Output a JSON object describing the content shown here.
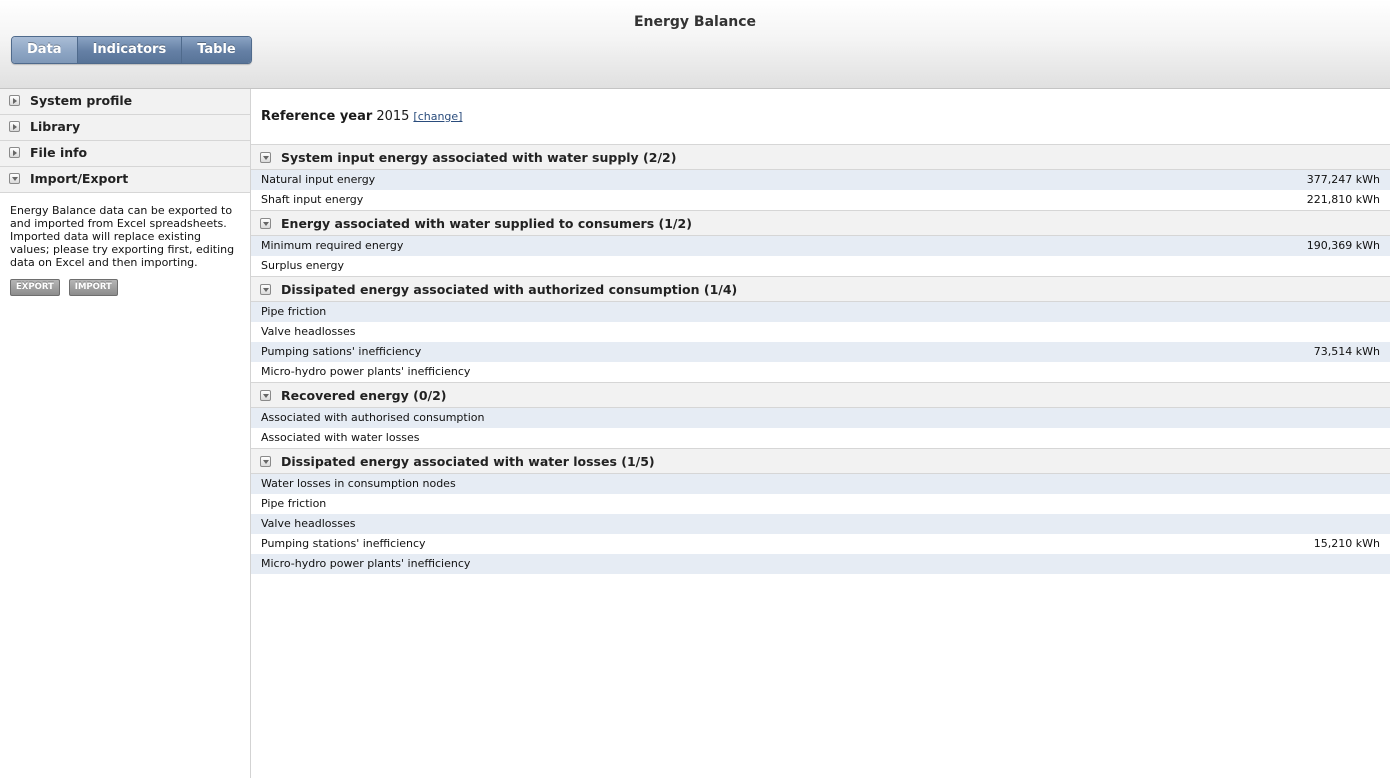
{
  "app": {
    "title": "Energy Balance"
  },
  "tabs": [
    {
      "label": "Data",
      "active": true
    },
    {
      "label": "Indicators",
      "active": false
    },
    {
      "label": "Table",
      "active": false
    }
  ],
  "sidebar": {
    "items": [
      {
        "label": "System profile",
        "expanded": false
      },
      {
        "label": "Library",
        "expanded": false
      },
      {
        "label": "File info",
        "expanded": false
      },
      {
        "label": "Import/Export",
        "expanded": true
      }
    ],
    "import_export": {
      "description": "Energy Balance data can be exported to and imported from Excel spreadsheets. Imported data will replace existing values; please try exporting first, editing data on Excel and then importing.",
      "export_label": "EXPORT",
      "import_label": "IMPORT"
    }
  },
  "main": {
    "reference": {
      "label": "Reference year",
      "year": "2015",
      "change_label": "[change]"
    },
    "sections": [
      {
        "title": "System input energy associated with water supply (2/2)",
        "rows": [
          {
            "label": "Natural input energy",
            "value": "377,247 kWh"
          },
          {
            "label": "Shaft input energy",
            "value": "221,810 kWh"
          }
        ]
      },
      {
        "title": "Energy associated with water supplied to consumers (1/2)",
        "rows": [
          {
            "label": "Minimum required energy",
            "value": "190,369 kWh"
          },
          {
            "label": "Surplus energy",
            "value": ""
          }
        ]
      },
      {
        "title": "Dissipated energy associated with authorized consumption (1/4)",
        "rows": [
          {
            "label": "Pipe friction",
            "value": ""
          },
          {
            "label": "Valve headlosses",
            "value": ""
          },
          {
            "label": "Pumping sations' inefficiency",
            "value": "73,514 kWh"
          },
          {
            "label": "Micro-hydro power plants' inefficiency",
            "value": ""
          }
        ]
      },
      {
        "title": "Recovered energy (0/2)",
        "rows": [
          {
            "label": "Associated with authorised consumption",
            "value": ""
          },
          {
            "label": "Associated with water losses",
            "value": ""
          }
        ]
      },
      {
        "title": "Dissipated energy associated with water losses (1/5)",
        "rows": [
          {
            "label": "Water losses in consumption nodes",
            "value": ""
          },
          {
            "label": "Pipe friction",
            "value": ""
          },
          {
            "label": "Valve headlosses",
            "value": ""
          },
          {
            "label": "Pumping stations' inefficiency",
            "value": "15,210 kWh"
          },
          {
            "label": "Micro-hydro power plants' inefficiency",
            "value": ""
          }
        ]
      }
    ]
  }
}
